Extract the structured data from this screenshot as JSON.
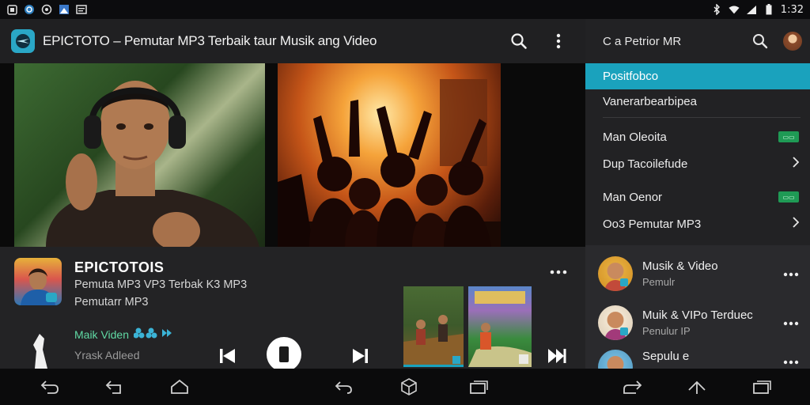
{
  "status_bar": {
    "icons_left": [
      "image-icon",
      "camera-icon",
      "sync-icon",
      "gallery-icon",
      "message-icon"
    ],
    "icons_right": [
      "bluetooth-icon",
      "wifi-icon",
      "signal-icon",
      "battery-icon"
    ],
    "time": "1:32"
  },
  "app_bar": {
    "title": "EPICTOTO – Pemutar MP3 Terbaik taur Musik ang Video",
    "icons": [
      "search-icon",
      "more-vert-icon"
    ]
  },
  "now_playing": {
    "title": "EPICTOTOIS",
    "subtitle_1": "Pemuta MP3 VP3 Terbak K3 MP3",
    "subtitle_2": "Pemutarr MP3",
    "tag": "Maik Viden",
    "tag_2": "Yrask Adleed",
    "controls": [
      "skip-previous-icon",
      "pause-icon",
      "skip-next-icon",
      "fast-forward-icon"
    ]
  },
  "drawer": {
    "header_title": "C a Petrior MR",
    "menu_items": [
      {
        "label": "Positfobco",
        "selected": true
      },
      {
        "label": "Vanerarbearbipea"
      },
      {
        "label": "Man Oleoita",
        "badge": "▭▭"
      },
      {
        "label": "Dup Tacoilefude"
      },
      {
        "label": "Man Oenor",
        "badge": "▭▭"
      },
      {
        "label": "Oo3 Pemutar MP3"
      }
    ],
    "list": [
      {
        "title": "Musik & Video",
        "subtitle": "Pemulr"
      },
      {
        "title": "Muik & VIPo Terduec",
        "subtitle": "Penulur IP"
      },
      {
        "title": "Sepulu e",
        "subtitle": ""
      }
    ]
  },
  "colors": {
    "accent": "#1aa2bd",
    "logo": "#2aa7c6",
    "tag_green": "#60d9a4",
    "badge_green": "#1f9a55"
  }
}
